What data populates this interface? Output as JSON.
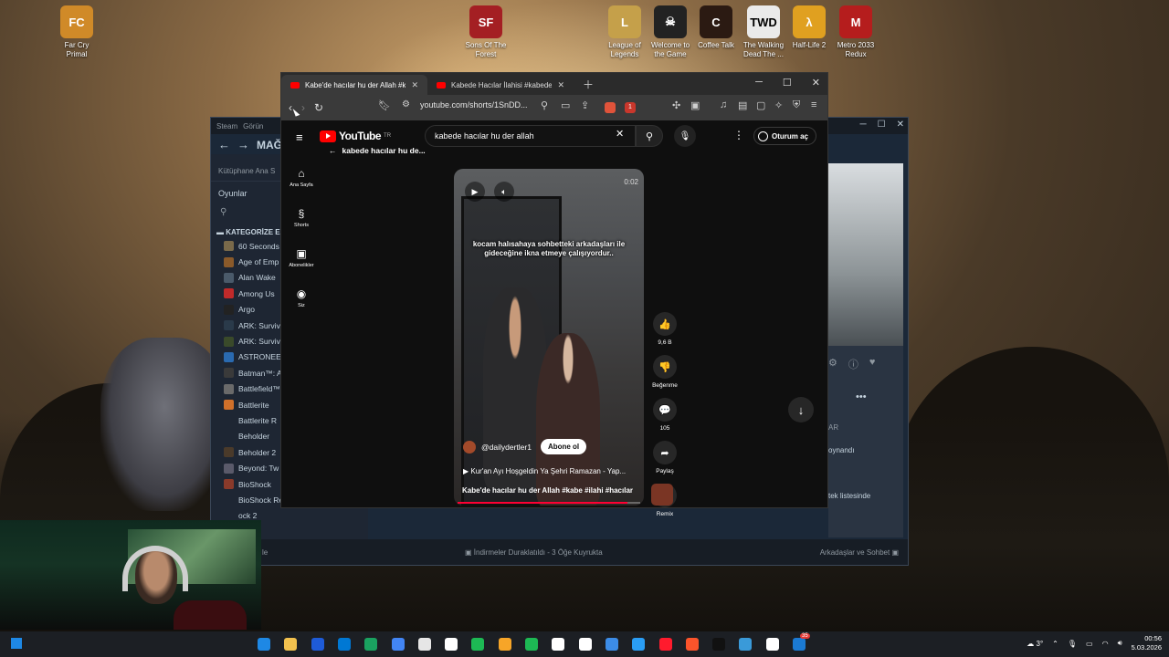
{
  "desktop_icons": [
    {
      "label": "Far Cry\nPrimal",
      "color": "#d08a28",
      "glyph": "FC"
    },
    {
      "label": "Sons Of The\nForest",
      "color": "#a41f23",
      "glyph": "SF"
    },
    {
      "label": "League of\nLegends",
      "color": "#c5a04a",
      "glyph": "L"
    },
    {
      "label": "Welcome to\nthe Game",
      "color": "#222222",
      "glyph": "☠"
    },
    {
      "label": "Coffee Talk",
      "color": "#2b1a12",
      "glyph": "C"
    },
    {
      "label": "The Walking\nDead The ...",
      "color": "#eaeaea",
      "glyph": "TWD"
    },
    {
      "label": "Half-Life 2",
      "color": "#e0a020",
      "glyph": "λ"
    },
    {
      "label": "Metro 2033\nRedux",
      "color": "#b51d1d",
      "glyph": "M"
    }
  ],
  "steam": {
    "app_label": "Steam",
    "menu_view": "Görün",
    "header_title": "MAĞ",
    "library_home": "Kütüphane Ana S",
    "games_header": "Oyunlar",
    "category_header": "KATEGORİZE E",
    "games": [
      {
        "name": "60 Seconds",
        "color": "#7a6a4a"
      },
      {
        "name": "Age of Emp",
        "color": "#8a5a2a"
      },
      {
        "name": "Alan Wake",
        "color": "#4a5a6a"
      },
      {
        "name": "Among Us",
        "color": "#c02a2a"
      },
      {
        "name": "Argo",
        "color": "#222222"
      },
      {
        "name": "ARK: Surviv",
        "color": "#2a3a4a"
      },
      {
        "name": "ARK: Surviv",
        "color": "#3a4a2a"
      },
      {
        "name": "ASTRONEE",
        "color": "#2a6ab0"
      },
      {
        "name": "Batman™: A",
        "color": "#3a3a3a"
      },
      {
        "name": "Battlefield™",
        "color": "#6a6a6a"
      },
      {
        "name": "Battlerite",
        "color": "#d0702a"
      },
      {
        "name": "Battlerite R",
        "color": "#1e2633"
      },
      {
        "name": "Beholder",
        "color": "#1e2633"
      },
      {
        "name": "Beholder 2",
        "color": "#4a3a2a"
      },
      {
        "name": "Beyond: Tw",
        "color": "#5a5a6a"
      },
      {
        "name": "BioShock",
        "color": "#8a3a2a"
      },
      {
        "name": "BioShock Remastered",
        "color": "#1e2633"
      },
      {
        "name": "ock 2",
        "color": "#1e2633"
      }
    ],
    "bottom_left": "le",
    "downloads_status": "İndirmeler Duraklatıldı - 3 Öğe Kuyrukta",
    "friends_chat": "Arkadaşlar ve Sohbet",
    "panel_label_1": "AR",
    "panel_label_2": "oynandı",
    "panel_label_3": "tek listesinde"
  },
  "browser": {
    "tabs": [
      {
        "title": "Kabe'de hacılar hu der Allah #ka",
        "active": true
      },
      {
        "title": "Kabede Hacılar İlahisi #kabedehacıla",
        "active": false
      }
    ],
    "url": "youtube.com/shorts/1SnDD...",
    "extension_badge": "1"
  },
  "youtube": {
    "logo_text": "YouTube",
    "logo_region": "TR",
    "search_query": "kabede hacılar hu der allah",
    "sign_in": "Oturum aç",
    "sidebar": [
      {
        "label": "Ana Sayfa",
        "icon": "home-icon",
        "glyph": "⌂"
      },
      {
        "label": "Shorts",
        "icon": "shorts-icon",
        "glyph": "§"
      },
      {
        "label": "Abonelikler",
        "icon": "subscriptions-icon",
        "glyph": "▣"
      },
      {
        "label": "Siz",
        "icon": "user-icon",
        "glyph": "◉"
      }
    ],
    "back_title": "kabede hacılar hu de...",
    "short": {
      "caption": "kocam halısahaya sohbetteki arkadaşları ile gideceğine ikna etmeye çalışıyordur..",
      "time": "0:02",
      "channel": "@dailydertler1",
      "subscribe": "Abone ol",
      "music": "Kur'an Ayı Hoşgeldin Ya Şehri Ramazan - Yap...",
      "title": "Kabe'de hacılar hu der Allah #kabe #ilahi #hacılar",
      "progress": 0.93
    },
    "actions": [
      {
        "label": "9,6 B",
        "icon": "like-icon",
        "glyph": "👍"
      },
      {
        "label": "Beğenme",
        "icon": "dislike-icon",
        "glyph": "👎"
      },
      {
        "label": "105",
        "icon": "comment-icon",
        "glyph": "💬"
      },
      {
        "label": "Paylaş",
        "icon": "share-icon",
        "glyph": "➦"
      },
      {
        "label": "Remix",
        "icon": "remix-icon",
        "glyph": "⟳"
      }
    ]
  },
  "taskbar": {
    "icon_colors": [
      "#1e88e5",
      "#f2c14e",
      "#1e5bd8",
      "#0078d4",
      "#1aa260",
      "#4285f4",
      "#e6e6e6",
      "#ffffff",
      "#1db954",
      "#f7a528",
      "#1db954",
      "#ffffff",
      "#ffffff",
      "#3c8ce7",
      "#2a9df4",
      "#ff1b2d",
      "#fb542b",
      "#111111",
      "#3a9ad9",
      "#ffffff",
      "#1b7ad3"
    ],
    "notification_badge": "35",
    "weather": "3°",
    "time": "00:56",
    "date": "5.03.2026"
  }
}
